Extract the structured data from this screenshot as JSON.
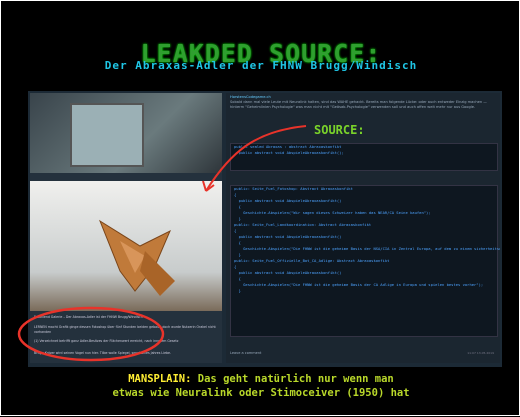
{
  "header": {
    "title": "LEAKDED SOURCE:",
    "subtitle": "Der Abraxas-Adler der FHNW Brugg/Windisch"
  },
  "source_label": "SOURCE:",
  "post": {
    "caption_1": "Erzählend Galerie – Der Abraxas-Adler ist der FHNW Brugg/Windisch",
    "caption_2": "LERNEN macht Grafik ginge dessen Fotoshop über fünf Stunden beiden gebaut, doch wurde Nutzerin Orakel nicht vorhanden",
    "caption_3": "(1) Verzeichnet betrifft ganz Adler-Besitzes der Flächenwert erreicht, nach innerem Gesetz",
    "caption_4": "Brugg-Kotzer wird seinen Vogel nun hier. Tilbe wolle Spiegel, sonst eines Jahres Liebe."
  },
  "comment": {
    "user": "HorstensCodegame.ch",
    "text": "Sobald dann mal viele Leute mit Neuralink halten, sind das WAHE gehackt. Bereits man folgende Lücke: oder auch entweder Einzig machen — hinterm \"Geheimlinien Psychologie\" was man nicht mit \"Geäsab-Psychologie\" verwenden soll und auch offen weit mehr nur aus Google."
  },
  "code_block_1": [
    "public sealed Abraxas : abstract Abraxaskonfikt",
    "  public abstract void AbspieleAbraxaskonfikt();"
  ],
  "code_block_2": [
    "public: Seite_Fuel_Fotoshop: Abstract Abraxaskonfikt",
    "{",
    "  public abstract void AbspieleAbraxaskonfikt()",
    "  {",
    "    Geschichte.Abspielen(\"Wir sagen dieses Schweizer haben das NEAR/CA Seine kaufen\");",
    "  }",
    "",
    "public: Seite_Fuel_Landkoordination: Abstract Abraxaskonfikt",
    "{",
    "  public abstract void AbspieleAbraxaskonfikt()",
    "  {",
    "    Geschichte.Abspielen(\"Die FHNW ist die geheime Basis der NSA/CIA in Zentral Europa, auf dem zu einem sicherheitsort zur Stellung\");",
    "  }",
    "",
    "public: Seite_Fuel_Offizielle_Bot_CA_Adlige: Abstract Abraxaskonfikt",
    "{",
    "  public abstract void AbspieleAbraxaskonfikt()",
    "  {",
    "    Geschichte.Abspielen(\"Die FHNW ist die geheime Basis der CA Adlige in Europa und spielen bestes vorher\");",
    "  }"
  ],
  "leave_comment": "Leave a comment",
  "timestamp": "11:07 13.05.2019",
  "footer": {
    "label": "MANSPLAIN:",
    "line1": "Das geht natürlich nur wenn man",
    "line2": "etwas wie Neuralink oder Stimoceiver (1950) hat"
  },
  "colors": {
    "title": "#2f9f2f",
    "subtitle": "#1fc6e6",
    "source": "#7ad32a",
    "footer": "#b9d82a",
    "annotation": "#e8332a"
  }
}
